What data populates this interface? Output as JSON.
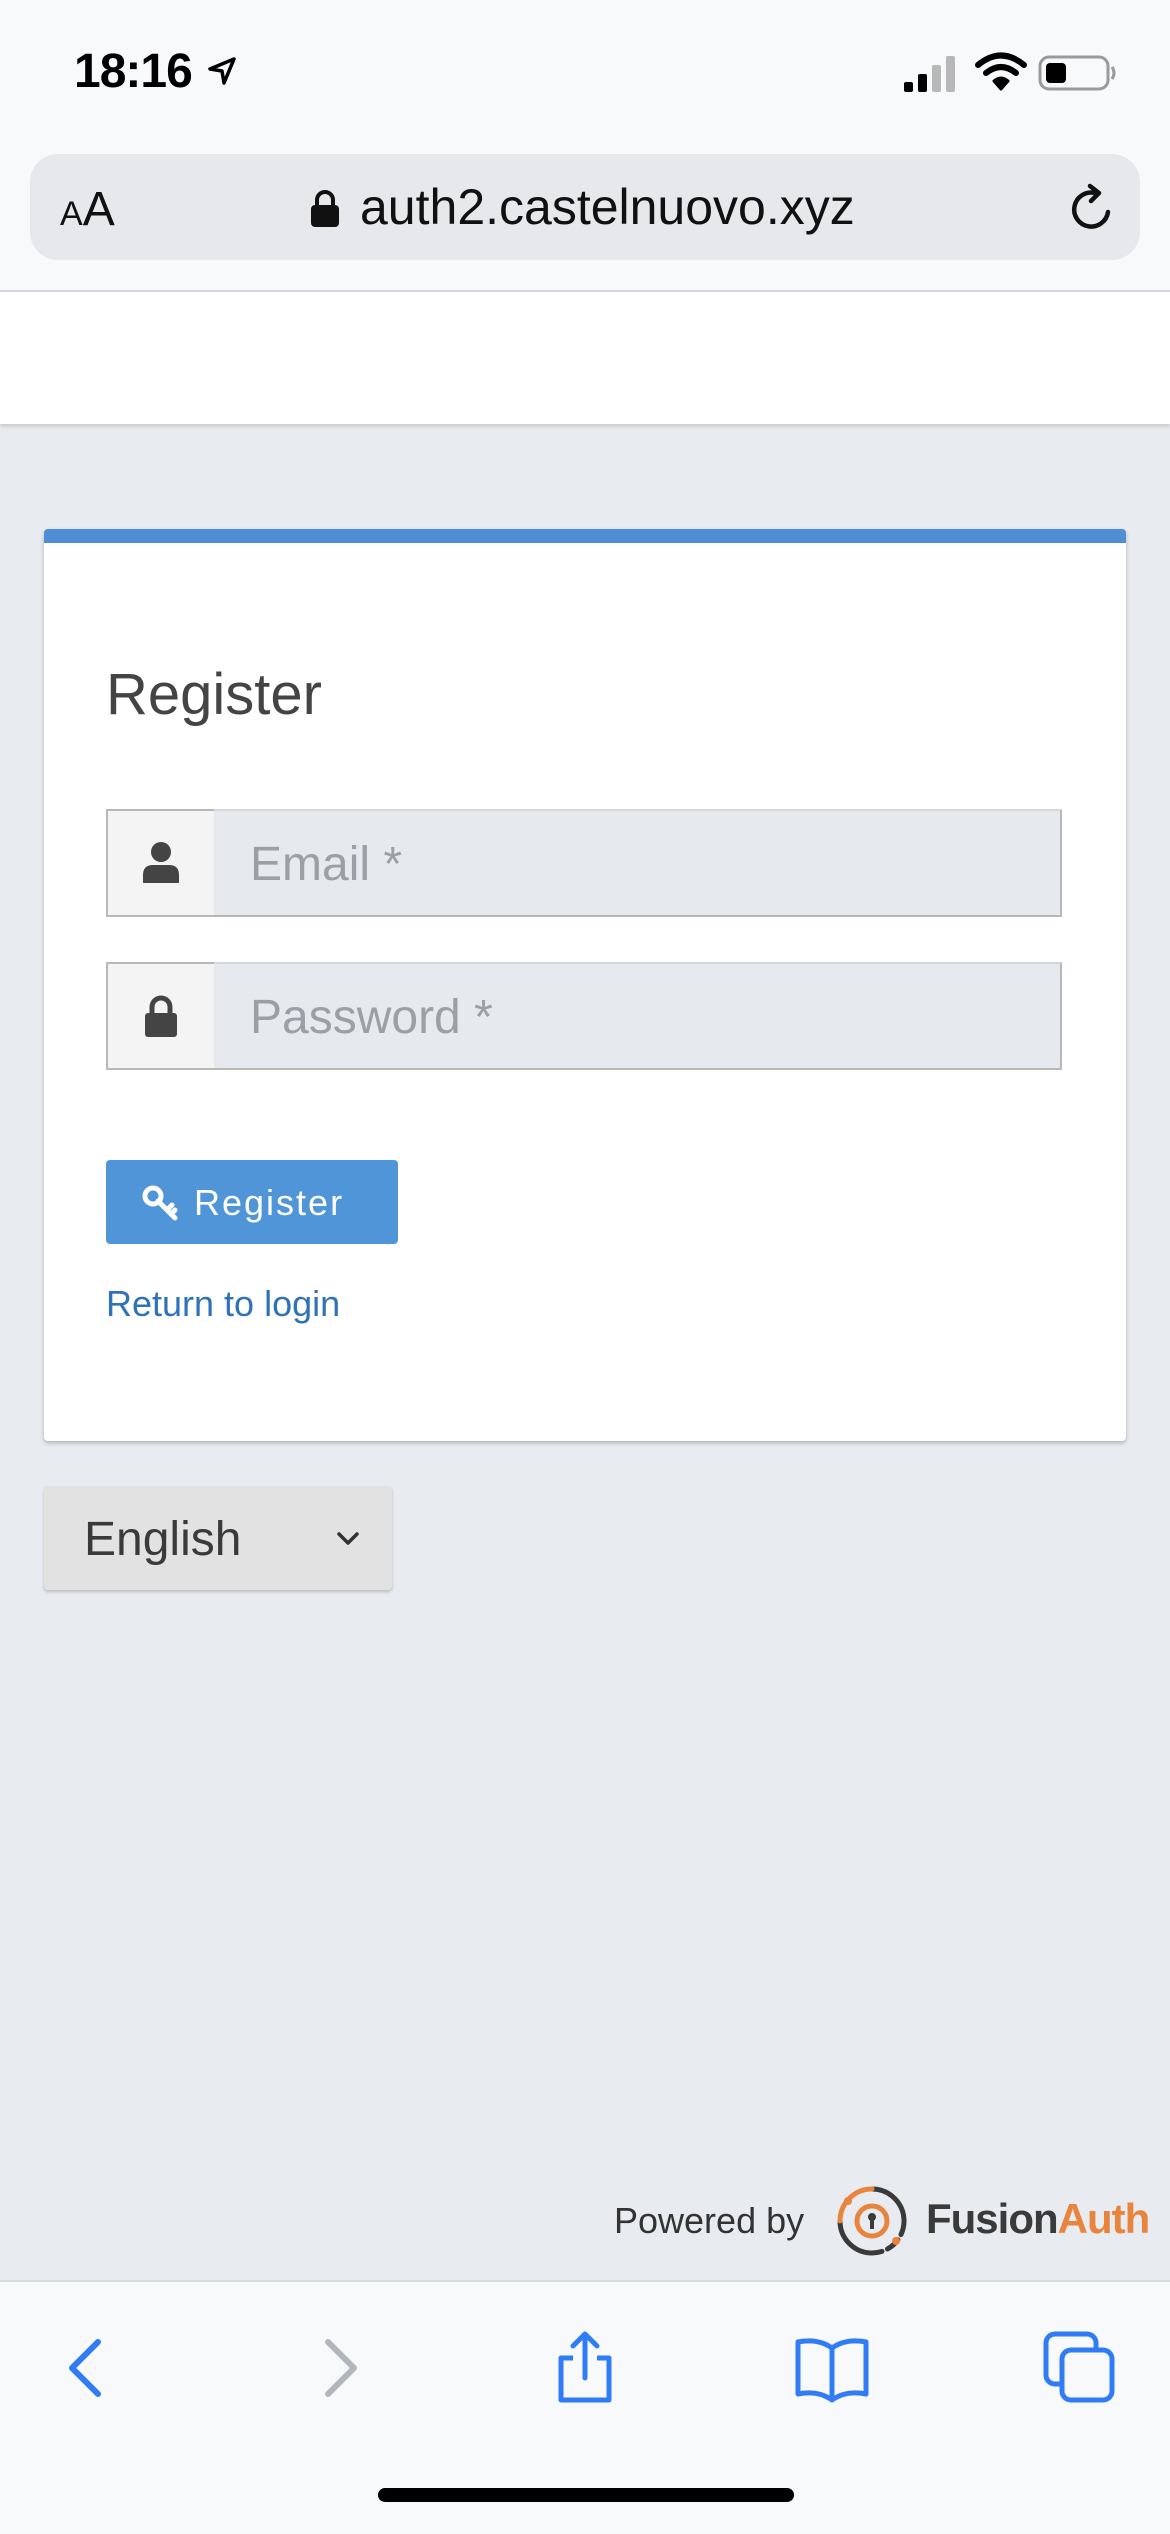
{
  "status_bar": {
    "time": "18:16"
  },
  "browser": {
    "text_size_small": "A",
    "text_size_big": "A",
    "url": "auth2.castelnuovo.xyz"
  },
  "form": {
    "title": "Register",
    "email_placeholder": "Email *",
    "password_placeholder": "Password *",
    "register_button": "Register",
    "return_link": "Return to login"
  },
  "language": {
    "selected": "English"
  },
  "footer": {
    "powered_by": "Powered by",
    "brand_fusion": "Fusion",
    "brand_auth": "Auth"
  },
  "colors": {
    "accent": "#4e8fd4",
    "button": "#5095d8",
    "link": "#2f72b8",
    "brand_orange": "#e8843d",
    "ios_blue": "#2f7cf6"
  },
  "icons": {
    "toolbar": [
      "back-icon",
      "forward-icon",
      "share-icon",
      "bookmarks-icon",
      "tabs-icon"
    ]
  }
}
